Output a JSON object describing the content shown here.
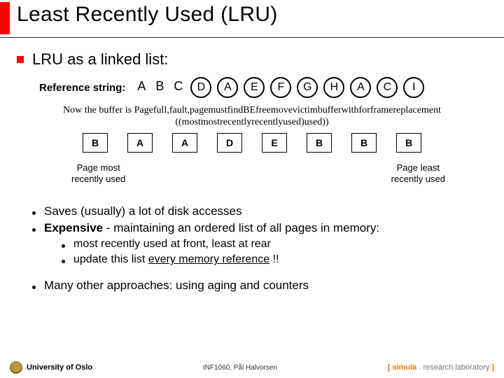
{
  "title": "Least Recently Used (LRU)",
  "h1": "LRU as a linked list:",
  "ref_label": "Reference string:",
  "ref": [
    "A",
    "B",
    "C",
    "D",
    "A",
    "E",
    "F",
    "G",
    "H",
    "A",
    "C",
    "I"
  ],
  "ref_circled_from": 3,
  "midline1": "Now the buffer is Pagefull,fault,pagemustfindBEfreemovevictimbufferwithforframereplacement",
  "midline2": "((mostmostrecentlyrecentlyused)used))",
  "ll": [
    "B",
    "A",
    "A",
    "D",
    "E",
    "B",
    "B",
    "B"
  ],
  "label_left_1": "Page most",
  "label_left_2": "recently used",
  "label_right_1": "Page least",
  "label_right_2": "recently used",
  "b1": "Saves (usually) a lot of disk accesses",
  "b2_strong": "Expensive",
  "b2_rest": " - maintaining an ordered list of all pages in memory:",
  "b2a": "most recently used at front, least at rear",
  "b2b_pre": "update this list ",
  "b2b_u": "every memory reference",
  "b2b_post": " !!",
  "b3": "Many other approaches: using aging and counters",
  "footer_uni": "University of Oslo",
  "footer_mid": "INF1060,   Pål Halvorsen",
  "footer_right_brand": "simula",
  "footer_right_rest": " . research laboratory"
}
